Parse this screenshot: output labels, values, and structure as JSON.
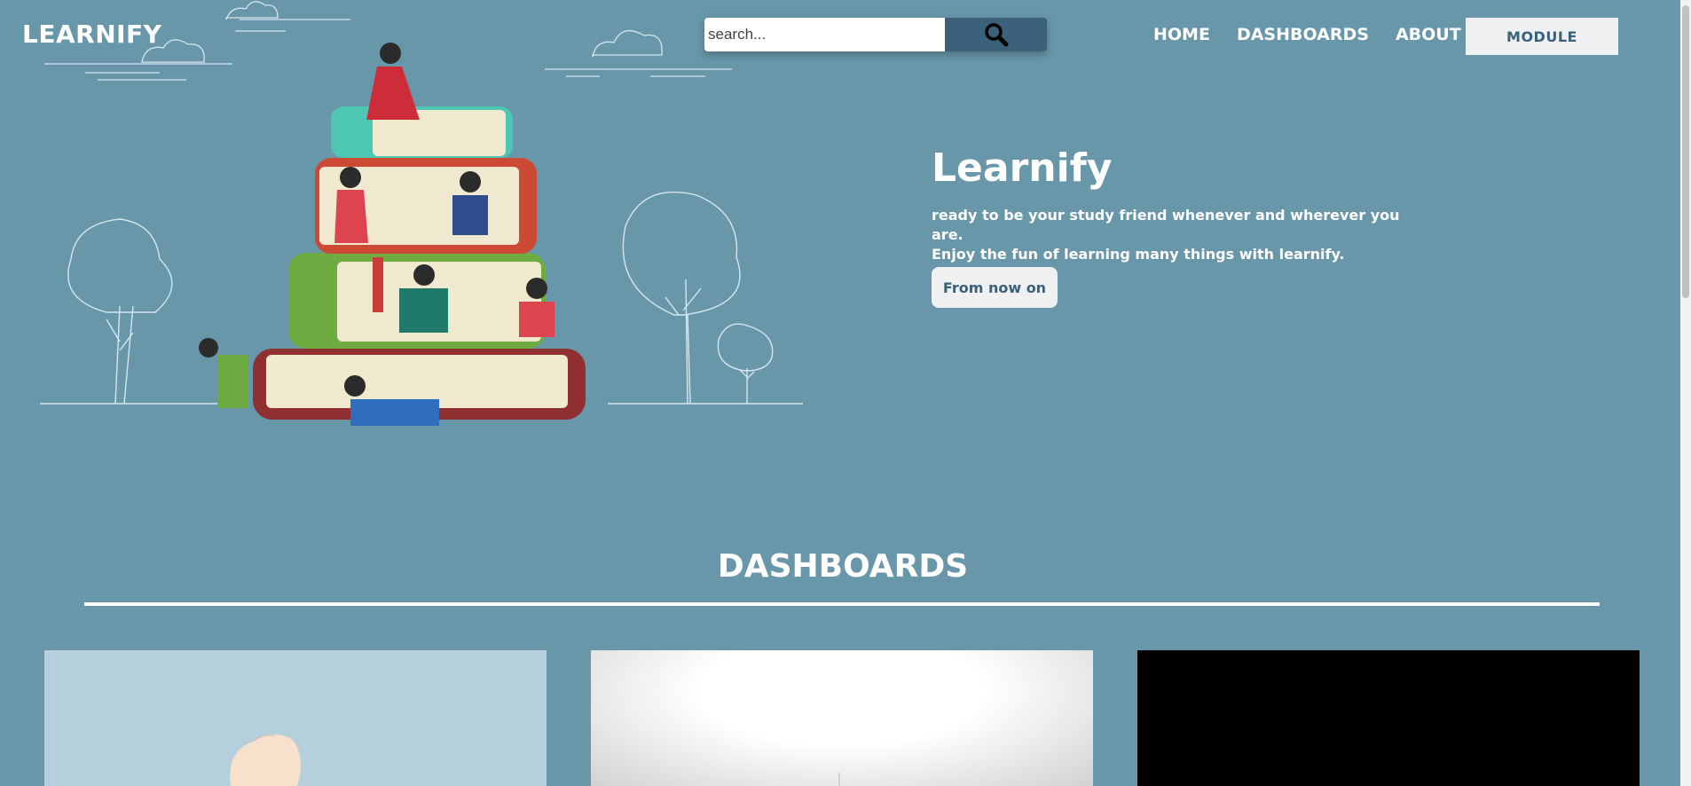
{
  "header": {
    "logo": "LEARNIFY",
    "search": {
      "placeholder": "search..."
    },
    "nav": [
      "HOME",
      "DASHBOARDS",
      "ABOUT"
    ],
    "module_button": "MODULE"
  },
  "hero": {
    "title": "Learnify",
    "line1": "ready to be your study friend whenever and wherever you are.",
    "line2": "Enjoy the fun of learning many things with learnify.",
    "button": "From now on"
  },
  "dashboards": {
    "title": "DASHBOARDS"
  },
  "colors": {
    "background": "#6897a9",
    "search_button": "#3b6079",
    "button_bg": "#eef0f2",
    "button_text": "#3b6079"
  },
  "icons": {
    "search": "search-icon"
  }
}
